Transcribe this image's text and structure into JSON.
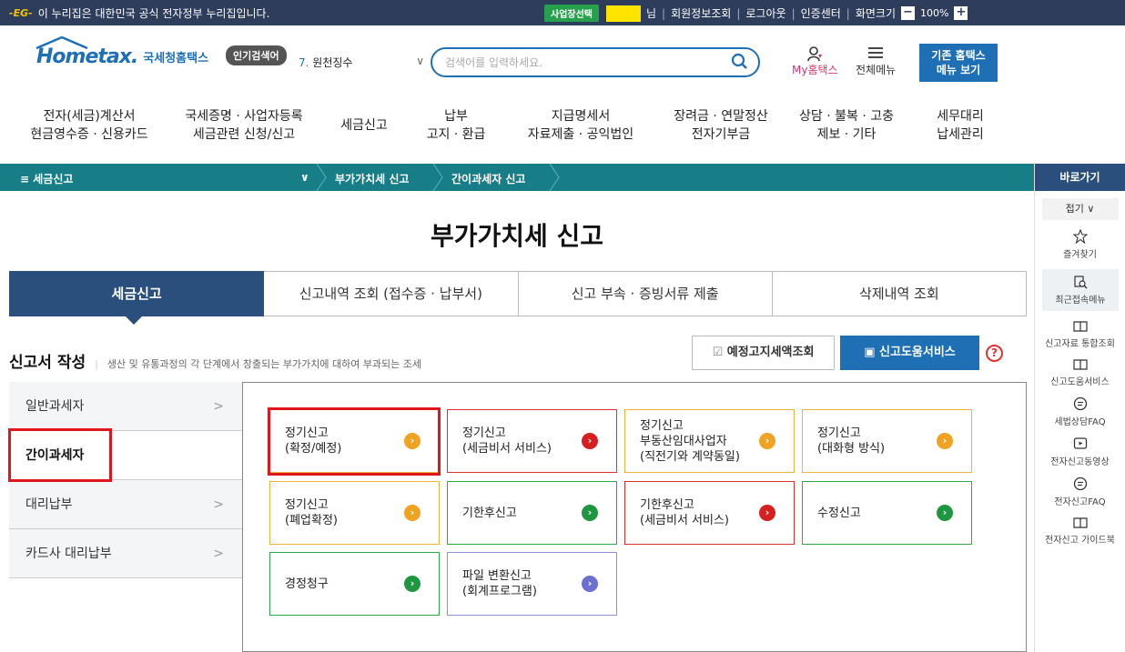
{
  "topbar": {
    "eg_logo": "-EG-",
    "gov_notice": "이 누리집은 대한민국 공식 전자정부 누리집입니다.",
    "business_select": "사업장선택",
    "user_suffix": "님",
    "member_info": "회원정보조회",
    "logout": "로그아웃",
    "cert_center": "인증센터",
    "screen_size": "화면크기",
    "zoom_level": "100%",
    "zoom_minus": "−",
    "zoom_plus": "+"
  },
  "header": {
    "logo_text": "Hometax.",
    "logo_korean": "국세청홈택스",
    "popular_label": "인기검색어",
    "popular_number": "7.",
    "popular_keyword": "원천징수",
    "search_placeholder": "검색어를 입력하세요.",
    "my_hometax": "My홈택스",
    "all_menu": "전체메뉴",
    "old_site_line1": "기존 홈택스",
    "old_site_line2": "메뉴 보기"
  },
  "gnb": [
    {
      "line1": "전자(세금)계산서",
      "line2": "현금영수증 · 신용카드"
    },
    {
      "line1": "국세증명 · 사업자등록",
      "line2": "세금관련 신청/신고"
    },
    {
      "line1": "세금신고",
      "line2": ""
    },
    {
      "line1": "납부",
      "line2": "고지 · 환급"
    },
    {
      "line1": "지급명세서",
      "line2": "자료제출 · 공익법인"
    },
    {
      "line1": "장려금 · 연말정산",
      "line2": "전자기부금"
    },
    {
      "line1": "상담 · 불복 · 고충",
      "line2": "제보 · 기타"
    },
    {
      "line1": "세무대리",
      "line2": "납세관리"
    }
  ],
  "breadcrumb": {
    "menu": "≡  세금신고",
    "level2": "부가가치세 신고",
    "level3": "간이과세자 신고"
  },
  "quick": {
    "title": "바로가기",
    "fold": "접기",
    "items": [
      "즐겨찾기",
      "최근접속메뉴",
      "신고자료 통합조회",
      "신고도움서비스",
      "세법상담FAQ",
      "전자신고동영상",
      "전자신고FAQ",
      "전자신고 가이드북"
    ]
  },
  "page_title": "부가가치세 신고",
  "tabs": [
    "세금신고",
    "신고내역 조회 (접수증 · 납부서)",
    "신고 부속 · 증빙서류 제출",
    "삭제내역 조회"
  ],
  "section": {
    "heading": "신고서 작성",
    "description": "생산 및 유통과정의 각 단계에서 창출되는 부가가치에 대하여 부과되는 조세",
    "notice_button": "예정고지세액조회",
    "help_button": "신고도움서비스",
    "help_q": "?"
  },
  "side_menu": [
    "일반과세자",
    "간이과세자",
    "대리납부",
    "카드사 대리납부"
  ],
  "cards": [
    {
      "line1": "정기신고",
      "line2": "(확정/예정)",
      "line3": "",
      "color": "orange"
    },
    {
      "line1": "정기신고",
      "line2": "(세금비서 서비스)",
      "line3": "",
      "color": "red"
    },
    {
      "line1": "정기신고",
      "line2": "부동산임대사업자",
      "line3": "(직전기와 계약동일)",
      "color": "orange"
    },
    {
      "line1": "정기신고",
      "line2": "(대화형 방식)",
      "line3": "",
      "color": "orange"
    },
    {
      "line1": "정기신고",
      "line2": "(폐업확정)",
      "line3": "",
      "color": "orange"
    },
    {
      "line1": "기한후신고",
      "line2": "",
      "line3": "",
      "color": "green"
    },
    {
      "line1": "기한후신고",
      "line2": "(세금비서 서비스)",
      "line3": "",
      "color": "red"
    },
    {
      "line1": "수정신고",
      "line2": "",
      "line3": "",
      "color": "green"
    },
    {
      "line1": "경정청구",
      "line2": "",
      "line3": "",
      "color": "green"
    },
    {
      "line1": "파일 변환신고",
      "line2": "(회계프로그램)",
      "line3": "",
      "color": "purple"
    }
  ],
  "colors": {
    "topbar": "#2f3d5c",
    "teal_bar": "#177e88",
    "brand_blue": "#1f6fb5",
    "navy": "#2a4f7c",
    "highlight_red": "#e0161e"
  }
}
